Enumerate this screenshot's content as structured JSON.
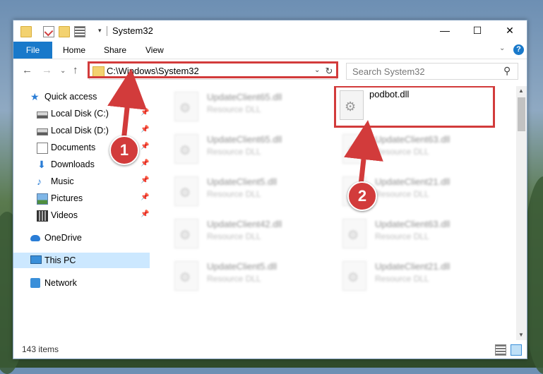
{
  "window": {
    "title": "System32",
    "controls": {
      "minimize": "—",
      "maximize": "☐",
      "close": "✕"
    }
  },
  "ribbon": {
    "tabs": [
      "File",
      "Home",
      "Share",
      "View"
    ],
    "help": "?"
  },
  "nav": {
    "address": "C:\\Windows\\System32",
    "search_placeholder": "Search System32"
  },
  "sidebar": {
    "items": [
      {
        "label": "Quick access",
        "icon": "star-icon"
      },
      {
        "label": "Local Disk (C:)",
        "icon": "disk-icon",
        "pinned": true
      },
      {
        "label": "Local Disk (D:)",
        "icon": "disk-icon",
        "pinned": true
      },
      {
        "label": "Documents",
        "icon": "document-icon",
        "pinned": true
      },
      {
        "label": "Downloads",
        "icon": "download-icon",
        "pinned": true
      },
      {
        "label": "Music",
        "icon": "music-icon",
        "pinned": true
      },
      {
        "label": "Pictures",
        "icon": "pictures-icon",
        "pinned": true
      },
      {
        "label": "Videos",
        "icon": "video-icon",
        "pinned": true
      },
      {
        "label": "OneDrive",
        "icon": "cloud-icon"
      },
      {
        "label": "This PC",
        "icon": "pc-icon",
        "selected": true
      },
      {
        "label": "Network",
        "icon": "network-icon"
      }
    ]
  },
  "files": {
    "left": [
      {
        "name": "UpdateClient65.dll",
        "type": "Resource DLL"
      },
      {
        "name": "UpdateClient65.dll",
        "type": "Resource DLL"
      },
      {
        "name": "UpdateClient5.dll",
        "type": "Resource DLL"
      },
      {
        "name": "UpdateClient42.dll",
        "type": "Resource DLL"
      },
      {
        "name": "UpdateClient5.dll",
        "type": "Resource DLL"
      }
    ],
    "right": [
      {
        "name": "podbot.dll",
        "type": ""
      },
      {
        "name": "UpdateClient63.dll",
        "type": "Resource DLL"
      },
      {
        "name": "UpdateClient21.dll",
        "type": "Resource DLL"
      },
      {
        "name": "UpdateClient63.dll",
        "type": "Resource DLL"
      },
      {
        "name": "UpdateClient21.dll",
        "type": "Resource DLL"
      }
    ]
  },
  "status": {
    "item_count": "143 items"
  },
  "annotations": {
    "step1": "1",
    "step2": "2",
    "color": "#d23b3b"
  }
}
